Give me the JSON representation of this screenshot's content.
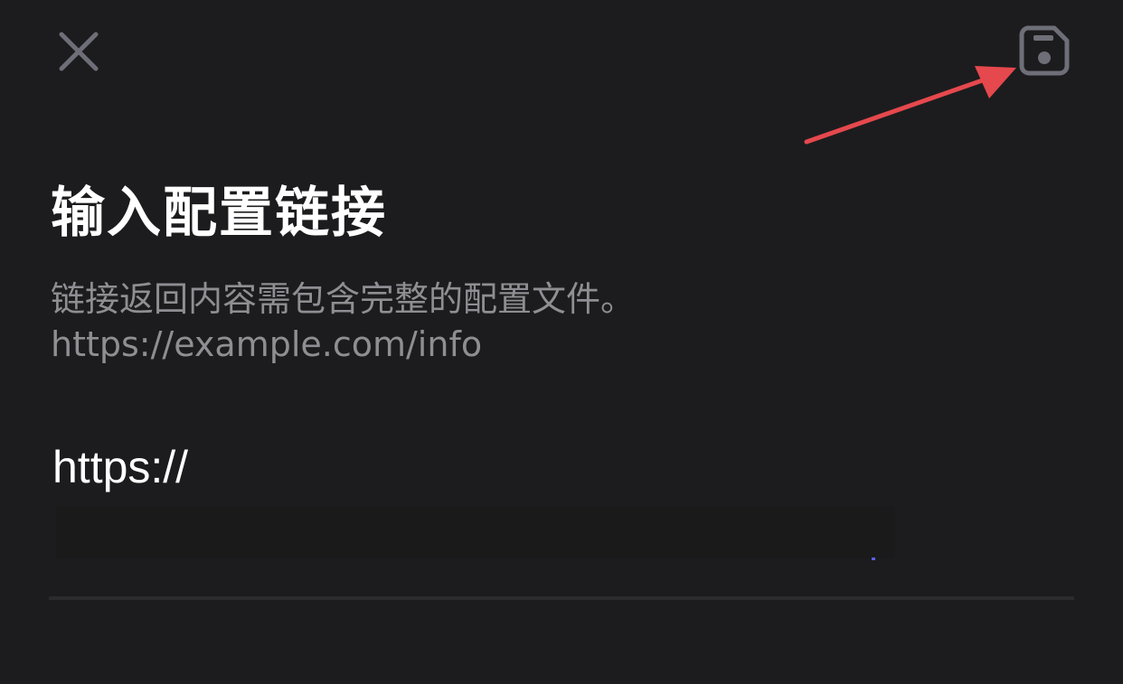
{
  "header": {
    "close_icon": "close-icon",
    "save_icon": "save-icon"
  },
  "main": {
    "title": "输入配置链接",
    "description_line1": "链接返回内容需包含完整的配置文件。",
    "description_line2": "https://example.com/info",
    "url_value": "https://"
  },
  "colors": {
    "background": "#1c1c1e",
    "icon": "#6e6e78",
    "annotation_arrow": "#e5484d",
    "cursor": "#5a5ef0"
  }
}
